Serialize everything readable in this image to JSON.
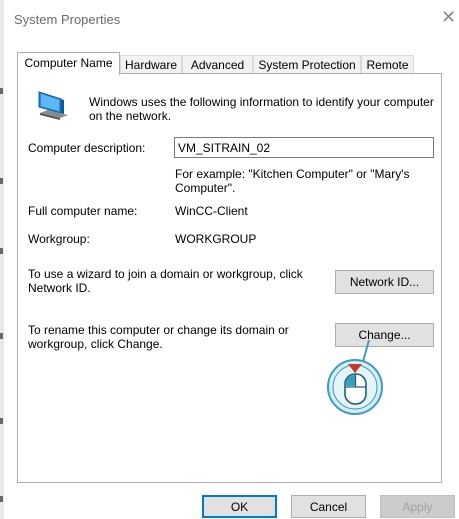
{
  "window": {
    "title": "System Properties",
    "close_glyph": "✕"
  },
  "tabs": [
    {
      "label": "Computer Name",
      "active": true
    },
    {
      "label": "Hardware",
      "active": false
    },
    {
      "label": "Advanced",
      "active": false
    },
    {
      "label": "System Protection",
      "active": false
    },
    {
      "label": "Remote",
      "active": false
    }
  ],
  "intro": {
    "text": "Windows uses the following information to identify your computer on the network.",
    "icon": "computer-icon"
  },
  "fields": {
    "description_label": "Computer description:",
    "description_value": "VM_SITRAIN_02",
    "example_text": "For example: \"Kitchen Computer\" or \"Mary's Computer\".",
    "full_name_label": "Full computer name:",
    "full_name_value": "WinCC-Client",
    "workgroup_label": "Workgroup:",
    "workgroup_value": "WORKGROUP"
  },
  "network_id": {
    "text": "To use a wizard to join a domain or workgroup, click Network ID.",
    "button_label": "Network ID..."
  },
  "rename": {
    "text": "To rename this computer or change its domain or workgroup, click Change.",
    "button_label": "Change..."
  },
  "footer": {
    "ok_label": "OK",
    "cancel_label": "Cancel",
    "apply_label": "Apply"
  },
  "callout": {
    "icon": "mouse-left-click-icon",
    "accent": "#3a9dbd",
    "fill": "#d7eef5",
    "arrow": "#c0392b"
  }
}
